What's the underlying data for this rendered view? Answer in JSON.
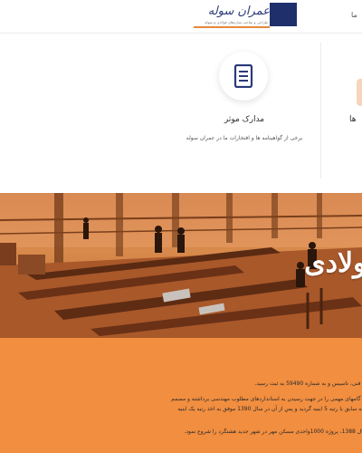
{
  "header": {
    "logo_title": "عمران سوله",
    "logo_tagline": "طراحی و ساخت سازه‌های فولادی و سوله",
    "menu_edge": "ما"
  },
  "features": {
    "item": {
      "icon": "document-icon",
      "title": "مدارک موثر",
      "description": "برخی از گواهینامه ها و افتخارات ما در عمران سوله"
    },
    "partial_title": "ها"
  },
  "hero": {
    "heading": "فولادی"
  },
  "about": {
    "line1": "ت فنی، تاسیس و به شماره 59490 به ثبت رسید.",
    "line2": "ت گامهای مهمی را در جهت رسیدن به استانداردهای مطلوب مهندسی برداشته و مصمم",
    "line3": "رجه سابق با رتبه 5 ابنیه گردید و پس از آن در سال 1390 موفق به اخذ رتبه یک ابنیه",
    "line4": "سال 1388، پروژه 1000واحدی مسکن مهر در شهر جدید هشتگرد را شروع نمود."
  },
  "colors": {
    "accent": "#f28e3f",
    "brand_navy": "#1f2f6b"
  }
}
